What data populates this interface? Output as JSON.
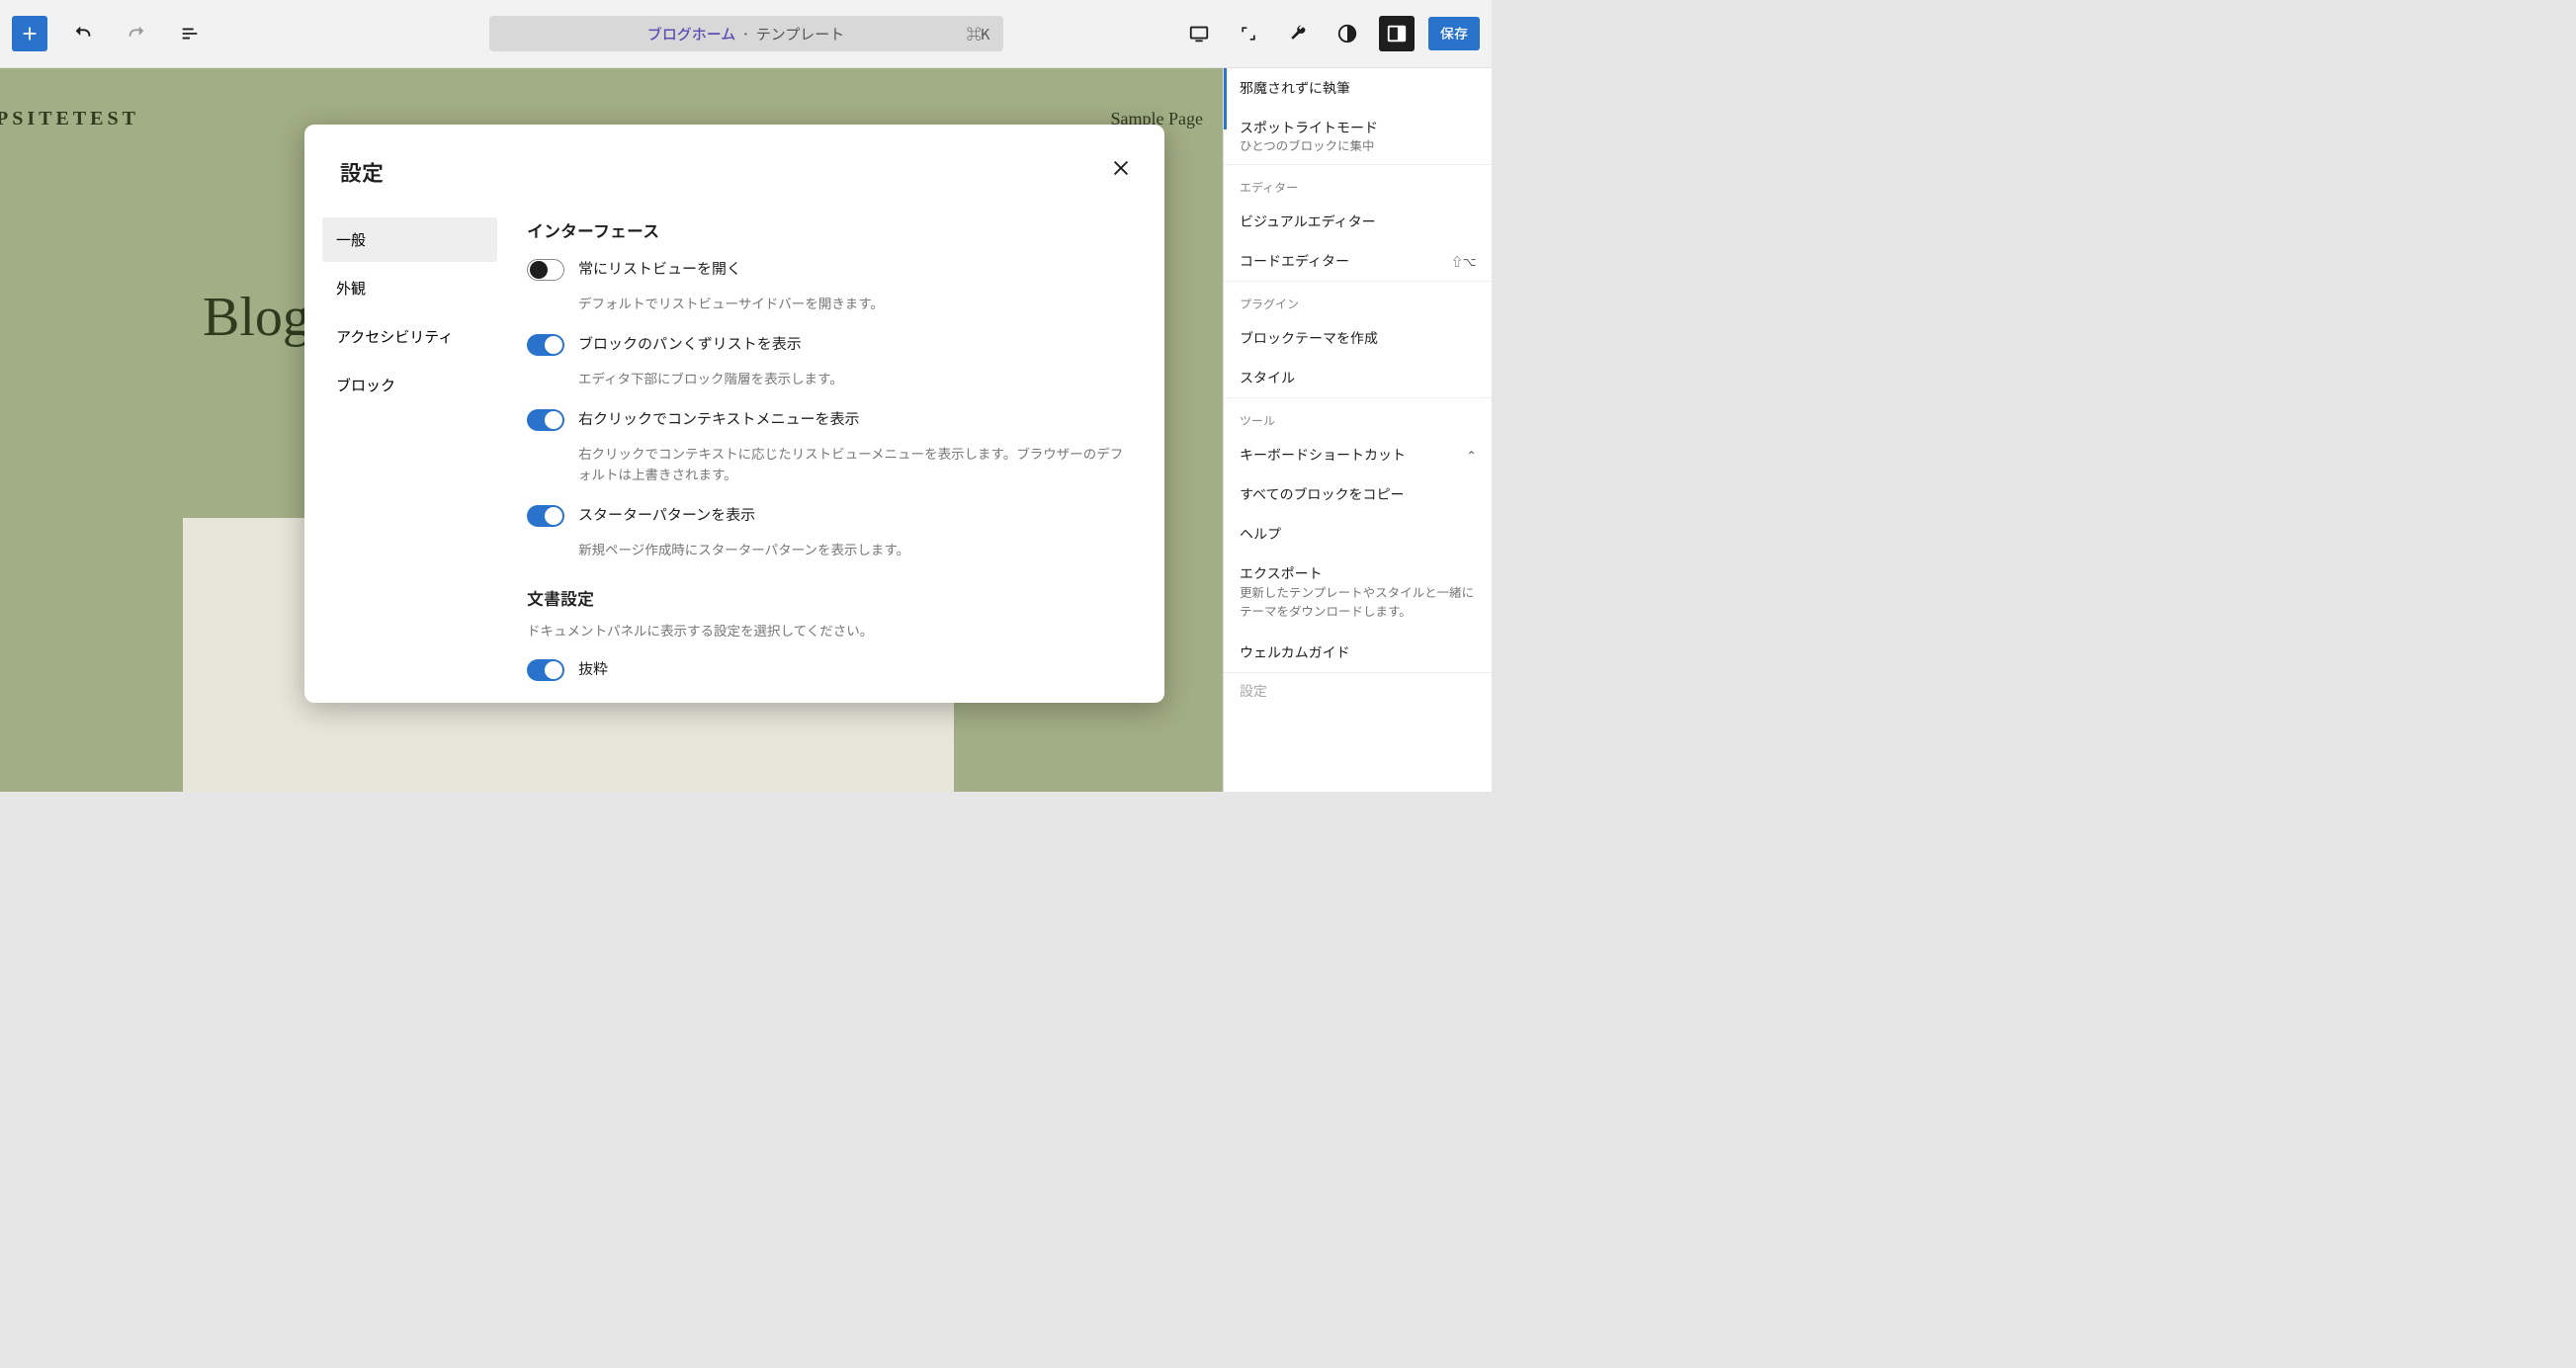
{
  "topbar": {
    "doc_name": "ブログホーム",
    "doc_type": "テンプレート",
    "shortcut": "⌘K",
    "save": "保存"
  },
  "canvas": {
    "site_title": "PSITETEST",
    "nav_link": "Sample Page",
    "heading": "Blog"
  },
  "sidebar": {
    "disturb": "邪魔されずに執筆",
    "spotlight": "スポットライトモード",
    "spotlight_sub": "ひとつのブロックに集中",
    "editor_label": "エディター",
    "visual_editor": "ビジュアルエディター",
    "code_editor": "コードエディター",
    "code_shortcut": "⇧⌥",
    "plugin_label": "プラグイン",
    "create_block_theme": "ブロックテーマを作成",
    "style": "スタイル",
    "tool_label": "ツール",
    "keyboard_shortcuts": "キーボードショートカット",
    "kbd_shortcut": "⌃",
    "copy_all_blocks": "すべてのブロックをコピー",
    "help": "ヘルプ",
    "export": "エクスポート",
    "export_desc": "更新したテンプレートやスタイルと一緒にテーマをダウンロードします。",
    "welcome_guide": "ウェルカムガイド",
    "settings_cut": "設定"
  },
  "dialog": {
    "title": "設定",
    "tabs": {
      "general": "一般",
      "appearance": "外観",
      "accessibility": "アクセシビリティ",
      "blocks": "ブロック"
    },
    "section_interface": "インターフェース",
    "opt_listview": "常にリストビューを開く",
    "opt_listview_desc": "デフォルトでリストビューサイドバーを開きます。",
    "opt_breadcrumb": "ブロックのパンくずリストを表示",
    "opt_breadcrumb_desc": "エディタ下部にブロック階層を表示します。",
    "opt_rightclick": "右クリックでコンテキストメニューを表示",
    "opt_rightclick_desc": "右クリックでコンテキストに応じたリストビューメニューを表示します。ブラウザーのデフォルトは上書きされます。",
    "opt_starter": "スターターパターンを表示",
    "opt_starter_desc": "新規ページ作成時にスターターパターンを表示します。",
    "section_document": "文書設定",
    "section_document_desc": "ドキュメントパネルに表示する設定を選択してください。",
    "opt_excerpt": "抜粋"
  }
}
